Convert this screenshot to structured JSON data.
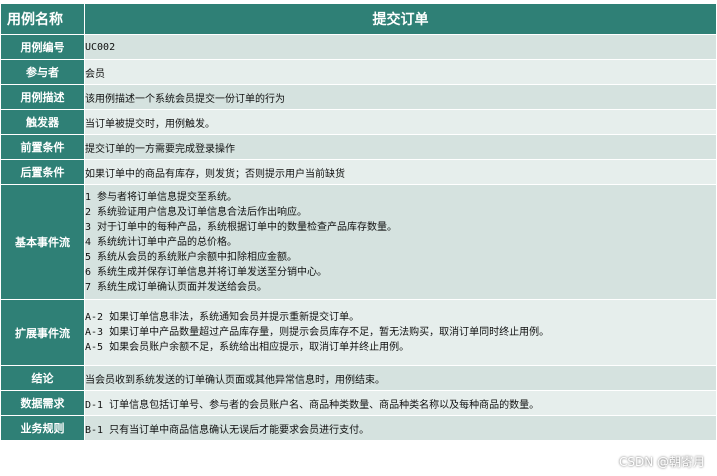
{
  "header": {
    "key": "用例名称",
    "value": "提交订单"
  },
  "rows": {
    "id": {
      "key": "用例编号",
      "value": "UC002"
    },
    "actor": {
      "key": "参与者",
      "value": "会员"
    },
    "desc": {
      "key": "用例描述",
      "value": "该用例描述一个系统会员提交一份订单的行为"
    },
    "trigger": {
      "key": "触发器",
      "value": "当订单被提交时，用例触发。"
    },
    "pre": {
      "key": "前置条件",
      "value": "提交订单的一方需要完成登录操作"
    },
    "post": {
      "key": "后置条件",
      "value": "如果订单中的商品有库存，则发货；否则提示用户当前缺货"
    },
    "basic_flow": {
      "key": "基本事件流",
      "lines": [
        "1 参与者将订单信息提交至系统。",
        "2 系统验证用户信息及订单信息合法后作出响应。",
        "3 对于订单中的每种产品，系统根据订单中的数量检查产品库存数量。",
        "4 系统统计订单中产品的总价格。",
        "5 系统从会员的系统账户余额中扣除相应金额。",
        "6 系统生成并保存订单信息并将订单发送至分销中心。",
        "7 系统生成订单确认页面并发送给会员。"
      ]
    },
    "ext_flow": {
      "key": "扩展事件流",
      "lines": [
        "A-2 如果订单信息非法，系统通知会员并提示重新提交订单。",
        "A-3 如果订单中产品数量超过产品库存量，则提示会员库存不足，暂无法购买，取消订单同时终止用例。",
        "A-5 如果会员账户余额不足，系统给出相应提示，取消订单并终止用例。"
      ]
    },
    "conclusion": {
      "key": "结论",
      "value": "当会员收到系统发送的订单确认页面或其他异常信息时，用例结束。"
    },
    "data_req": {
      "key": "数据需求",
      "value": "D-1 订单信息包括订单号、参与者的会员账户名、商品种类数量、商品种类名称以及每种商品的数量。"
    },
    "biz_rule": {
      "key": "业务规则",
      "value": "B-1 只有当订单中商品信息确认无误后才能要求会员进行支付。"
    }
  },
  "watermark": "CSDN @朝寄月"
}
